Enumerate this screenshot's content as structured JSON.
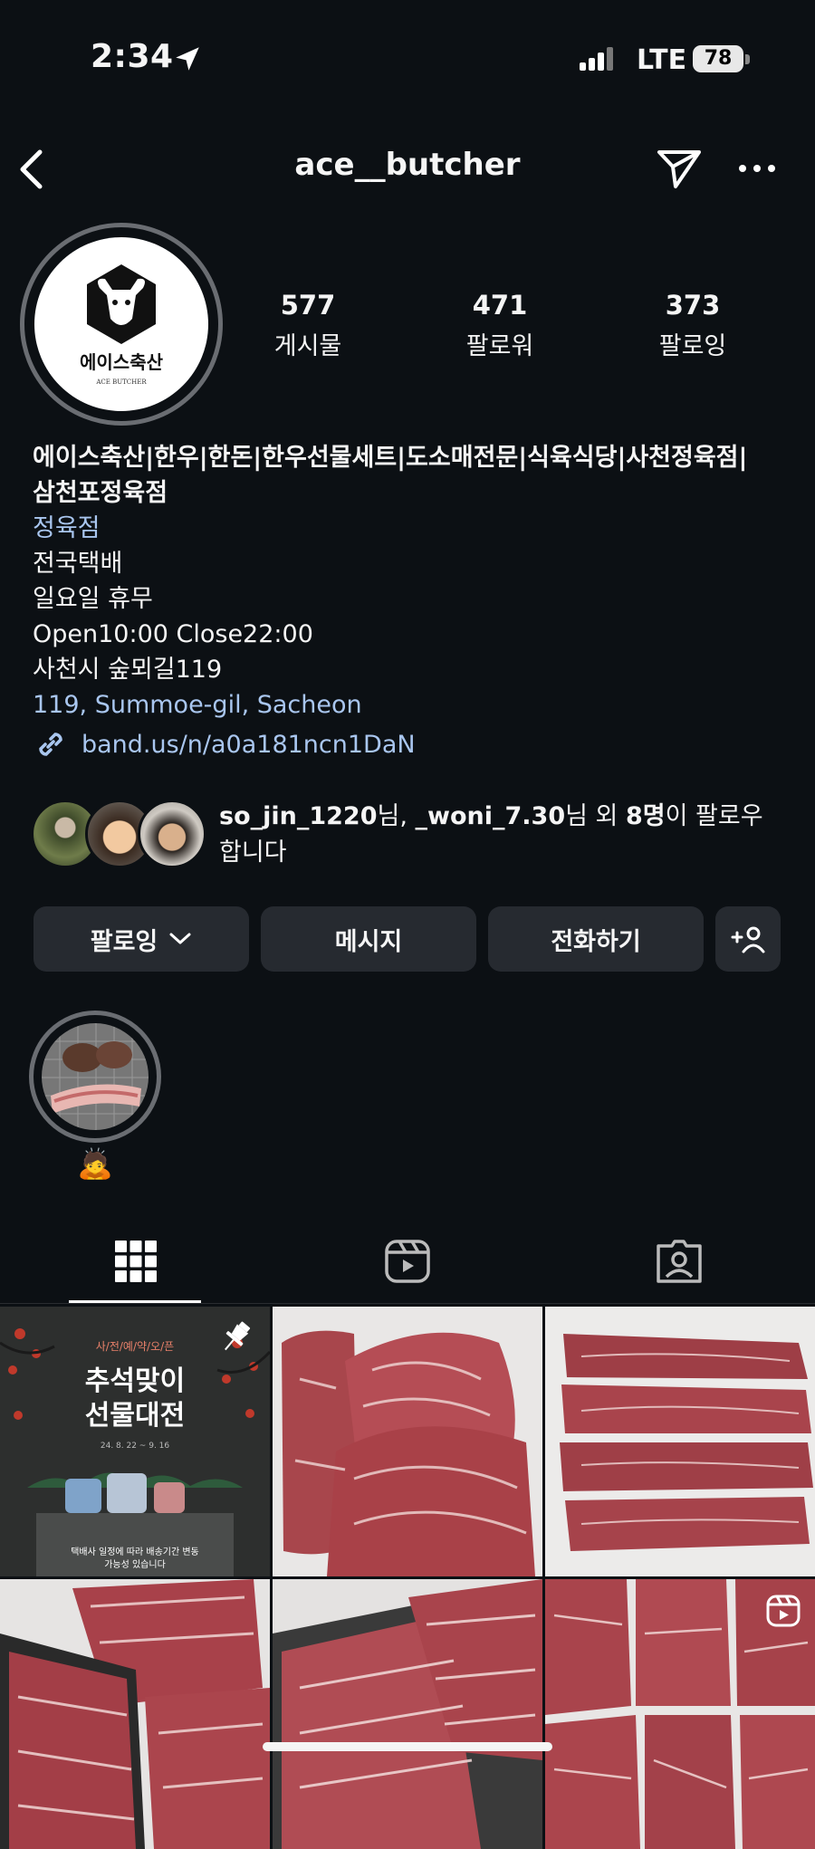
{
  "status_bar": {
    "time": "2:34",
    "network": "LTE",
    "battery": "78"
  },
  "header": {
    "username": "ace__butcher"
  },
  "profile": {
    "logo_text": "에이스축산",
    "logo_subtext": "ACE BUTCHER",
    "stats": [
      {
        "value": "577",
        "label": "게시물"
      },
      {
        "value": "471",
        "label": "팔로워"
      },
      {
        "value": "373",
        "label": "팔로잉"
      }
    ],
    "bio_name_line1": "에이스축산|한우|한돈|한우선물세트|도소매전문|식육식당|사천정육점|",
    "bio_name_line2": "삼천포정육점",
    "category": "정육점",
    "bio_lines": [
      "전국택배",
      "일요일 휴무",
      "Open10:00 Close22:00",
      "사천시 숲뫼길119"
    ],
    "address": "119, Summoe-gil, Sacheon",
    "link": "band.us/n/a0a181ncn1DaN"
  },
  "followed_by": {
    "user1": "so_jin_1220",
    "sep1": "님, ",
    "user2": "_woni_7.30",
    "sep2": "님 외 ",
    "others": "8명",
    "suffix": "이 팔로우",
    "suffix2": "합니다"
  },
  "buttons": {
    "following": "팔로잉",
    "message": "메시지",
    "call": "전화하기"
  },
  "highlights": [
    {
      "label": "🙇"
    }
  ],
  "grid_posts": [
    {
      "type": "pinned",
      "top_text": "사/전/예/약/오/픈",
      "title1": "추석맞이",
      "title2": "선물대전",
      "dates": "24. 8. 22 ~ 9. 16",
      "bottom1": "택배사 일정에 따라 배송기간 변동",
      "bottom2": "가능성 있습니다"
    },
    {
      "type": "photo"
    },
    {
      "type": "photo"
    },
    {
      "type": "photo"
    },
    {
      "type": "photo"
    },
    {
      "type": "reel"
    }
  ],
  "colors": {
    "background": "#0c1014",
    "link": "#a9c6ef",
    "button": "#262a30"
  }
}
